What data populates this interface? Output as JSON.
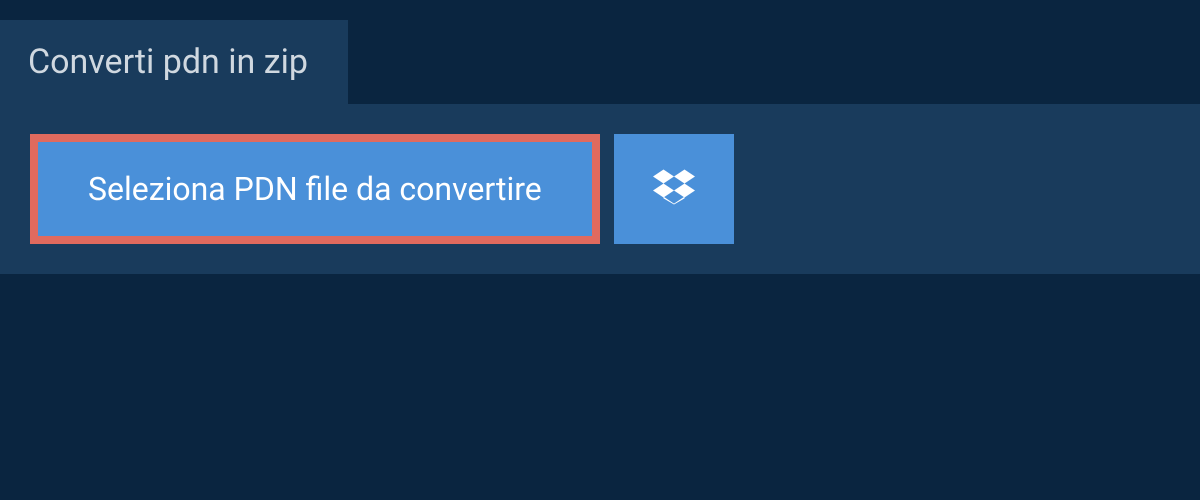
{
  "tab": {
    "title": "Converti pdn in zip"
  },
  "actions": {
    "select_file_label": "Seleziona PDN file da convertire"
  },
  "colors": {
    "background_dark": "#0a2540",
    "panel": "#193b5c",
    "button_blue": "#4a90d9",
    "highlight_border": "#e06a5e",
    "text_light": "#d0d8e0",
    "text_white": "#ffffff"
  }
}
